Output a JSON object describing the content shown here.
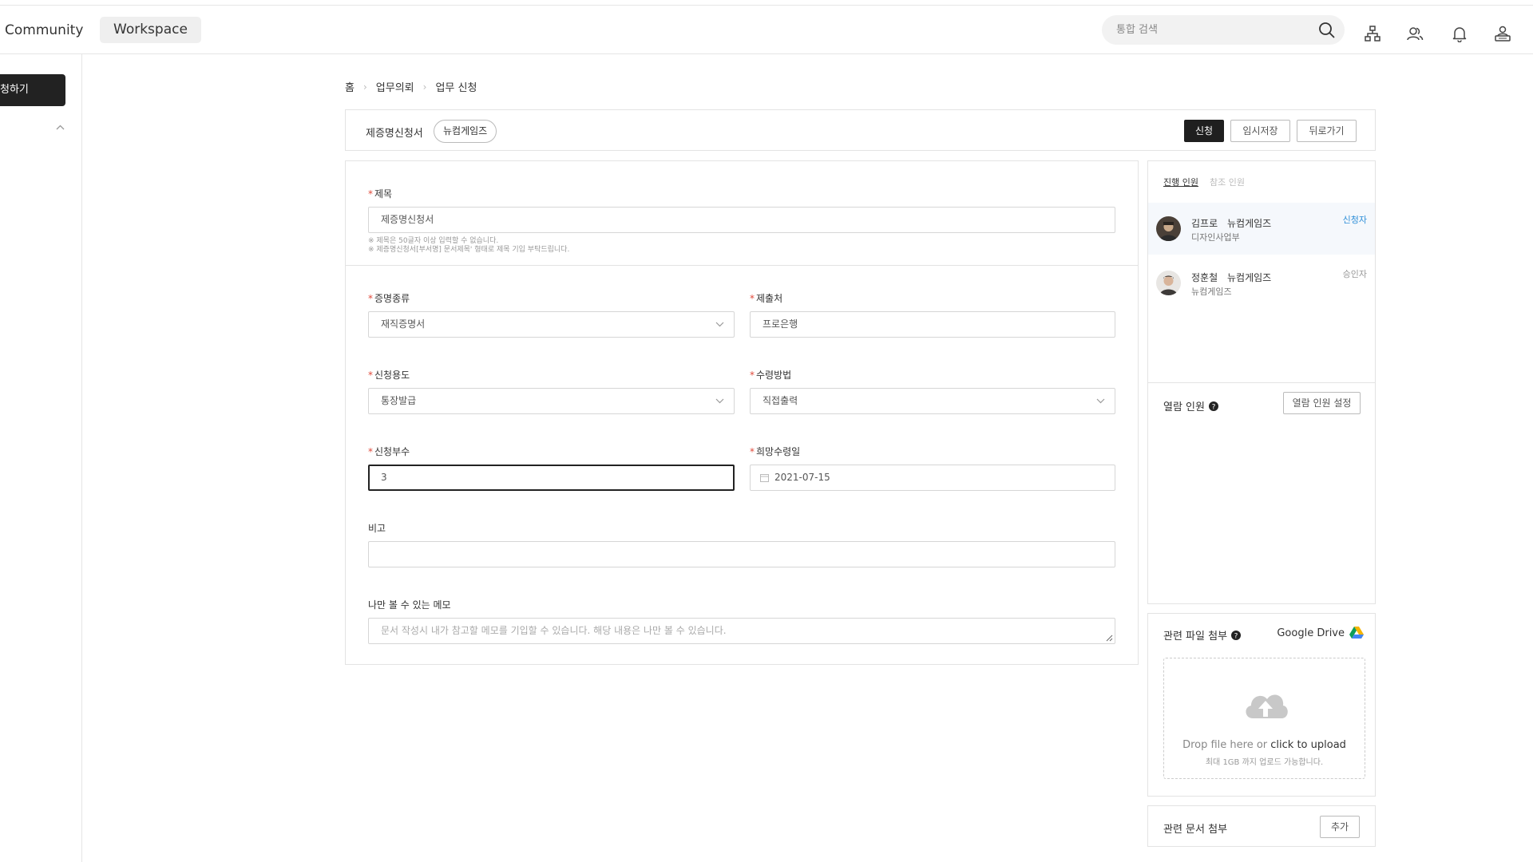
{
  "topbar": {
    "nav_community": "Community",
    "nav_workspace": "Workspace",
    "search_placeholder": "통합 검색"
  },
  "sidebar": {
    "primary_button": "청하기"
  },
  "breadcrumb": [
    "홈",
    "업무의뢰",
    "업무 신청"
  ],
  "header": {
    "doc_type": "제증명신청서",
    "org_chip": "뉴컴게임즈",
    "submit_label": "신청",
    "save_draft_label": "임시저장",
    "back_label": "뒤로가기"
  },
  "form": {
    "title": {
      "label": "제목",
      "value": "제증명신청서",
      "hint1": "※ 제목은 50글자 이상 입력할 수 없습니다.",
      "hint2": "※ 제증명신청서[부서명] 문서제목' 형태로 제목 기입 부탁드립니다."
    },
    "cert_type": {
      "label": "증명종류",
      "value": "재직증명서"
    },
    "submit_to": {
      "label": "제출처",
      "value": "프로은행"
    },
    "purpose": {
      "label": "신청용도",
      "value": "통장발급"
    },
    "receive_method": {
      "label": "수령방법",
      "value": "직접출력"
    },
    "copies": {
      "label": "신청부수",
      "value": "3"
    },
    "desired_date": {
      "label": "희망수령일",
      "value": "2021-07-15"
    },
    "remarks": {
      "label": "비고",
      "value": ""
    },
    "private_memo": {
      "label": "나만 볼 수 있는 메모",
      "placeholder": "문서 작성시 내가 참고할 메모를 기입할 수 있습니다. 해당 내용은 나만 볼 수 있습니다."
    }
  },
  "people_panel": {
    "tab_progress": "진행 인원",
    "tab_reference": "참조 인원",
    "people": [
      {
        "name": "김프로",
        "org": "뉴컴게임즈",
        "dept": "디자인사업부",
        "role": "신청자",
        "role_color": "#2f8fd8"
      },
      {
        "name": "정훈철",
        "org": "뉴컴게임즈",
        "dept": "뉴컴게임즈",
        "role": "승인자",
        "role_color": "#999999"
      }
    ],
    "viewers_title": "열람 인원",
    "viewers_button": "열람 인원 설정"
  },
  "attachments": {
    "title": "관련 파일 첨부",
    "gdrive_label": "Google Drive",
    "drop_text_prefix": "Drop file here or",
    "drop_text_link": "click to upload",
    "drop_subtext": "최대 1GB 까지 업로드 가능합니다."
  },
  "related_docs": {
    "title": "관련 문서 첨부",
    "add_button": "추가"
  }
}
